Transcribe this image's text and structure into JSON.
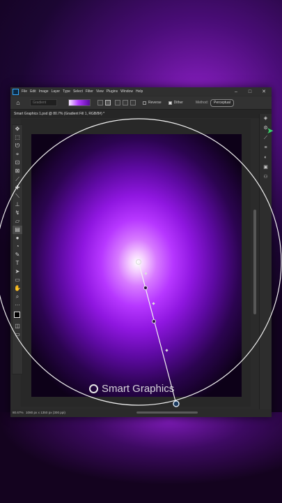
{
  "menubar": {
    "items": [
      "File",
      "Edit",
      "Image",
      "Layer",
      "Type",
      "Select",
      "Filter",
      "View",
      "Plugins",
      "Window",
      "Help"
    ]
  },
  "window_controls": {
    "minimize": "–",
    "maximize": "□",
    "close": "✕"
  },
  "options": {
    "preset_placeholder": "Gradient",
    "reverse_label": "Reverse",
    "reverse_checked": false,
    "dither_label": "Dither",
    "dither_checked": true,
    "method_label": "Method:",
    "method_value": "Perceptual"
  },
  "document": {
    "tab_title": "Smart Graphics 1.psd @ 80.7% (Gradient Fill 1, RGB/8#) *"
  },
  "status": {
    "zoom": "80.67%",
    "info": "1080 px x 1350 px (300 ppi)"
  },
  "watermark": {
    "text": "Smart Graphics"
  },
  "tools": [
    "move-icon",
    "marquee-icon",
    "lasso-icon",
    "object-select-icon",
    "crop-icon",
    "frame-icon",
    "eyedropper-icon",
    "healing-icon",
    "brush-icon",
    "stamp-icon",
    "history-brush-icon",
    "eraser-icon",
    "gradient-icon",
    "blur-icon",
    "dodge-icon",
    "pen-icon",
    "type-icon",
    "path-select-icon",
    "rectangle-icon",
    "hand-icon",
    "zoom-icon",
    "more-tools-icon"
  ],
  "colors": {
    "accent": "#31a8ff",
    "gradient_center": "#ffffff",
    "gradient_mid": "#b637ff",
    "gradient_edge": "#0d0118"
  }
}
